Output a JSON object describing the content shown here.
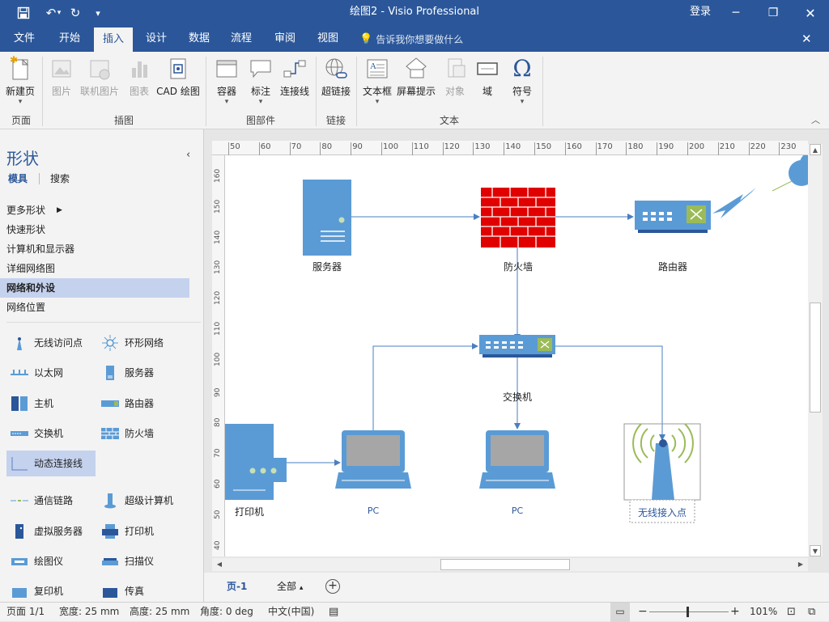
{
  "window": {
    "title": "绘图2 - Visio Professional",
    "login": "登录",
    "qat_more": "▾"
  },
  "menu": {
    "tabs": [
      "文件",
      "开始",
      "插入",
      "设计",
      "数据",
      "流程",
      "审阅",
      "视图"
    ],
    "active": "插入",
    "tell_me": "告诉我你想要做什么"
  },
  "ribbon": {
    "buttons": {
      "new_page": "新建页",
      "picture": "图片",
      "online_picture": "联机图片",
      "chart": "图表",
      "cad": "CAD 绘图",
      "container": "容器",
      "callout": "标注",
      "connector": "连接线",
      "hyperlink": "超链接",
      "textbox": "文本框",
      "screentip": "屏幕提示",
      "object": "对象",
      "field": "域",
      "symbol": "符号"
    },
    "groups": {
      "pages": "页面",
      "illustrations": "插图",
      "diagram_parts": "图部件",
      "links": "链接",
      "text": "文本"
    }
  },
  "shapes_panel": {
    "title": "形状",
    "tab_stencils": "模具",
    "tab_search": "搜索",
    "more_shapes": "更多形状",
    "stencils": [
      "快速形状",
      "计算机和显示器",
      "详细网络图",
      "网络和外设",
      "网络位置"
    ],
    "selected_stencil": "网络和外设",
    "shapes_left": [
      "无线访问点",
      "以太网",
      "主机",
      "交换机",
      "动态连接线",
      "通信链路",
      "虚拟服务器",
      "绘图仪",
      "复印机"
    ],
    "shapes_right": [
      "环形网络",
      "服务器",
      "路由器",
      "防火墙",
      "",
      "超级计算机",
      "打印机",
      "扫描仪",
      "传真"
    ]
  },
  "rulers": {
    "h_ticks": [
      "50",
      "60",
      "70",
      "80",
      "90",
      "100",
      "110",
      "120",
      "130",
      "140",
      "150",
      "160",
      "170",
      "180",
      "190",
      "200",
      "210",
      "220",
      "230"
    ],
    "v_ticks": [
      "160",
      "150",
      "140",
      "130",
      "120",
      "110",
      "100",
      "90",
      "80",
      "70",
      "60",
      "50",
      "40"
    ]
  },
  "diagram": {
    "labels": {
      "server": "服务器",
      "firewall": "防火墙",
      "router": "路由器",
      "switch": "交换机",
      "printer": "打印机",
      "pc1": "PC",
      "pc2": "PC",
      "wap": "无线接入点"
    },
    "colors": {
      "accent": "#5b9bd5",
      "firewall": "#e00000",
      "line": "#4a7fc1"
    }
  },
  "sheets": {
    "page1": "页-1",
    "all": "全部",
    "all_arrow": "▴"
  },
  "status": {
    "page": "页面 1/1",
    "width": "宽度: 25 mm",
    "height": "高度: 25 mm",
    "angle": "角度: 0 deg",
    "language": "中文(中国)",
    "zoom": "101%"
  }
}
